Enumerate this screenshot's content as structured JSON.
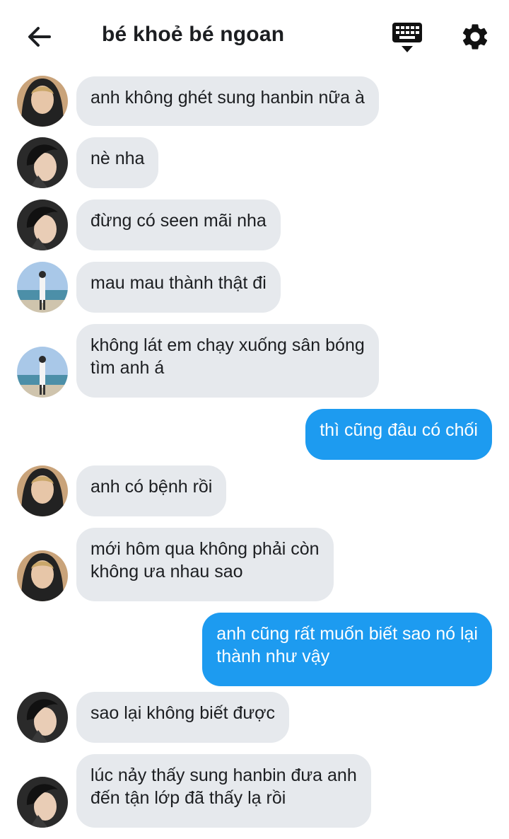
{
  "header": {
    "title": "bé khoẻ bé ngoan",
    "back_icon": "arrow-left-icon",
    "keyboard_icon": "keyboard-icon",
    "settings_icon": "gear-icon"
  },
  "colors": {
    "incoming_bubble": "#e6e9ed",
    "outgoing_bubble": "#1d9bf0",
    "text_dark": "#1c1e21",
    "text_light": "#ffffff"
  },
  "messages": [
    {
      "from": "incoming",
      "avatar": "avatar-hoodie",
      "lines": [
        "anh không ghét sung hanbin nữa à"
      ]
    },
    {
      "from": "incoming",
      "avatar": "avatar-dark-hair",
      "lines": [
        "nè nha"
      ]
    },
    {
      "from": "incoming",
      "avatar": "avatar-dark-hair",
      "lines": [
        "đừng có seen mãi nha"
      ]
    },
    {
      "from": "incoming",
      "avatar": "avatar-beach",
      "lines": [
        "mau mau thành thật đi"
      ]
    },
    {
      "from": "incoming",
      "avatar": "avatar-beach",
      "lines": [
        "không lát em chạy xuống sân bóng",
        "tìm anh á"
      ]
    },
    {
      "from": "outgoing",
      "lines": [
        "thì cũng đâu có chối"
      ]
    },
    {
      "from": "incoming",
      "avatar": "avatar-hoodie",
      "lines": [
        "anh có bệnh rồi"
      ]
    },
    {
      "from": "incoming",
      "avatar": "avatar-hoodie",
      "lines": [
        "mới hôm qua không phải còn",
        "không ưa nhau sao"
      ]
    },
    {
      "from": "outgoing",
      "lines": [
        "anh cũng rất muốn biết sao nó lại",
        "thành như vậy"
      ]
    },
    {
      "from": "incoming",
      "avatar": "avatar-dark-hair",
      "lines": [
        "sao lại không biết được"
      ]
    },
    {
      "from": "incoming",
      "avatar": "avatar-dark-hair",
      "lines": [
        "lúc nảy thấy sung hanbin đưa anh",
        "đến tận lớp đã thấy lạ rồi"
      ]
    }
  ]
}
